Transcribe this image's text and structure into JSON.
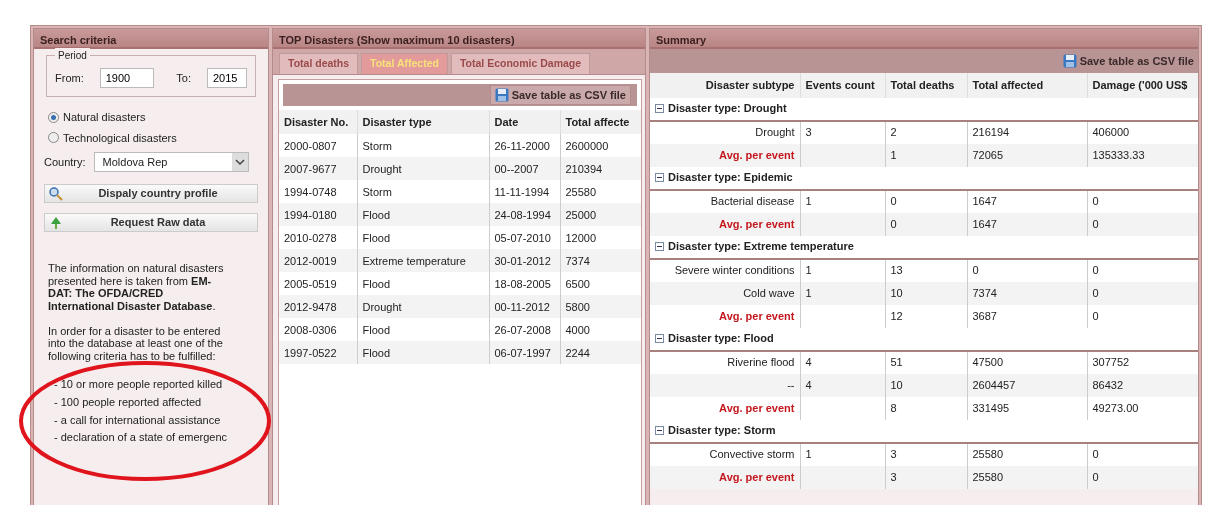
{
  "search_panel": {
    "title": "Search criteria",
    "period": {
      "legend": "Period",
      "from_label": "From:",
      "from_value": "1900",
      "to_label": "To:",
      "to_value": "2015"
    },
    "radios": [
      {
        "label": "Natural disasters",
        "selected": true
      },
      {
        "label": "Technological disasters",
        "selected": false
      }
    ],
    "country": {
      "label": "Country:",
      "value": "Moldova Rep"
    },
    "buttons": [
      {
        "label": "Dispaly country profile",
        "kind": "search"
      },
      {
        "label": "Request Raw data",
        "kind": "upload"
      }
    ],
    "info": "The information on natural disasters presented here is taken from **EM-DAT: The OFDA/CRED International Disaster Database**.",
    "criteria_intro": "In order for a disaster to be entered into the database at least one of the following criteria has to be fulfilled:",
    "criteria": [
      "- 10 or more people reported killed",
      "- 100 people reported affected",
      "- a call for international assistance",
      "- declaration of a state of emergenc"
    ]
  },
  "top_panel": {
    "title": "TOP Disasters (Show maximum 10 disasters)",
    "tabs": [
      {
        "label": "Total deaths",
        "selected": false
      },
      {
        "label": "Total Affected",
        "selected": true
      },
      {
        "label": "Total Economic Damage",
        "selected": false
      }
    ],
    "save_button": "Save table as CSV file",
    "columns": [
      "Disaster No.",
      "Disaster type",
      "Date",
      "Total affecte"
    ],
    "rows": [
      [
        "2000-0807",
        "Storm",
        "26-11-2000",
        "2600000"
      ],
      [
        "2007-9677",
        "Drought",
        "00--2007",
        "210394"
      ],
      [
        "1994-0748",
        "Storm",
        "11-11-1994",
        "25580"
      ],
      [
        "1994-0180",
        "Flood",
        "24-08-1994",
        "25000"
      ],
      [
        "2010-0278",
        "Flood",
        "05-07-2010",
        "12000"
      ],
      [
        "2012-0019",
        "Extreme temperature",
        "30-01-2012",
        "7374"
      ],
      [
        "2005-0519",
        "Flood",
        "18-08-2005",
        "6500"
      ],
      [
        "2012-9478",
        "Drought",
        "00-11-2012",
        "5800"
      ],
      [
        "2008-0306",
        "Flood",
        "26-07-2008",
        "4000"
      ],
      [
        "1997-0522",
        "Flood",
        "06-07-1997",
        "2244"
      ]
    ]
  },
  "summary_panel": {
    "title": "Summary",
    "save_button": "Save table as CSV file",
    "columns": [
      "Disaster subtype",
      "Events count",
      "Total deaths",
      "Total affected",
      "Damage ('000 US$"
    ],
    "groups": [
      {
        "title": "Disaster type: Drought",
        "expanded": true,
        "rows": [
          {
            "kind": "item",
            "subtype": "Drought",
            "events": "3",
            "deaths": "2",
            "affected": "216194",
            "damage": "406000"
          },
          {
            "kind": "average",
            "subtype": "Avg. per event",
            "deaths": "1",
            "affected": "72065",
            "damage": "135333.33"
          }
        ]
      },
      {
        "title": "Disaster type: Epidemic",
        "expanded": true,
        "rows": [
          {
            "kind": "item",
            "subtype": "Bacterial disease",
            "events": "1",
            "deaths": "0",
            "affected": "1647",
            "damage": "0"
          },
          {
            "kind": "average",
            "subtype": "Avg. per event",
            "deaths": "0",
            "affected": "1647",
            "damage": "0"
          }
        ]
      },
      {
        "title": "Disaster type: Extreme temperature",
        "expanded": true,
        "rows": [
          {
            "kind": "item",
            "subtype": "Severe winter conditions",
            "events": "1",
            "deaths": "13",
            "affected": "0",
            "damage": "0"
          },
          {
            "kind": "item",
            "subtype": "Cold wave",
            "events": "1",
            "deaths": "10",
            "affected": "7374",
            "damage": "0"
          },
          {
            "kind": "average",
            "subtype": "Avg. per event",
            "deaths": "12",
            "affected": "3687",
            "damage": "0"
          }
        ]
      },
      {
        "title": "Disaster type: Flood",
        "expanded": true,
        "rows": [
          {
            "kind": "item",
            "subtype": "Riverine flood",
            "events": "4",
            "deaths": "51",
            "affected": "47500",
            "damage": "307752"
          },
          {
            "kind": "item",
            "subtype": "--",
            "events": "4",
            "deaths": "10",
            "affected": "2604457",
            "damage": "86432"
          },
          {
            "kind": "average",
            "subtype": "Avg. per event",
            "deaths": "8",
            "affected": "331495",
            "damage": "49273.00"
          }
        ]
      },
      {
        "title": "Disaster type: Storm",
        "expanded": true,
        "rows": [
          {
            "kind": "item",
            "subtype": "Convective storm",
            "events": "1",
            "deaths": "3",
            "affected": "25580",
            "damage": "0"
          },
          {
            "kind": "average",
            "subtype": "Avg. per event",
            "deaths": "3",
            "affected": "25580",
            "damage": "0"
          }
        ]
      }
    ]
  }
}
